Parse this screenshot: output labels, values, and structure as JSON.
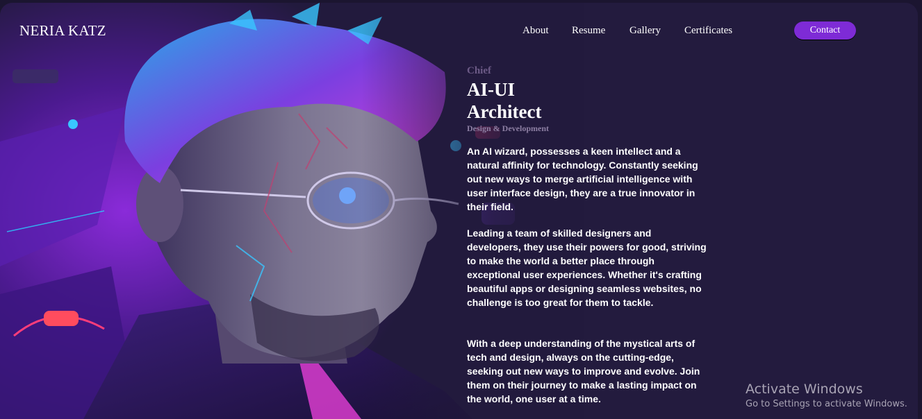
{
  "brand": {
    "name": "NERIA KATZ"
  },
  "nav": {
    "items": [
      {
        "label": "About"
      },
      {
        "label": "Resume"
      },
      {
        "label": "Gallery"
      },
      {
        "label": "Certificates"
      }
    ],
    "contact_label": "Contact"
  },
  "hero": {
    "eyebrow": "Chief",
    "title_line1": "AI-UI",
    "title_line2": "Architect",
    "subtitle": "Design & Development",
    "paragraphs": [
      "An AI wizard, possesses a keen intellect and a natural affinity for technology. Constantly seeking out new ways to merge artificial intelligence with user interface design, they are a true innovator in their field.",
      "Leading a team of skilled designers and developers, they use their powers for good, striving to make the world a better place through exceptional user experiences. Whether it's crafting beautiful apps or designing seamless websites, no challenge is too great for them to tackle.",
      "With a deep understanding of the mystical arts of tech and design, always on the cutting-edge, seeking out new ways to improve and evolve. Join them on their journey to make a lasting impact on the world, one user at a time."
    ]
  },
  "os_watermark": {
    "title": "Activate Windows",
    "subtitle": "Go to Settings to activate Windows."
  },
  "colors": {
    "background": "#221a3d",
    "accent": "#7e2bd6",
    "text": "#ffffff",
    "muted": "#8d7fa3"
  }
}
